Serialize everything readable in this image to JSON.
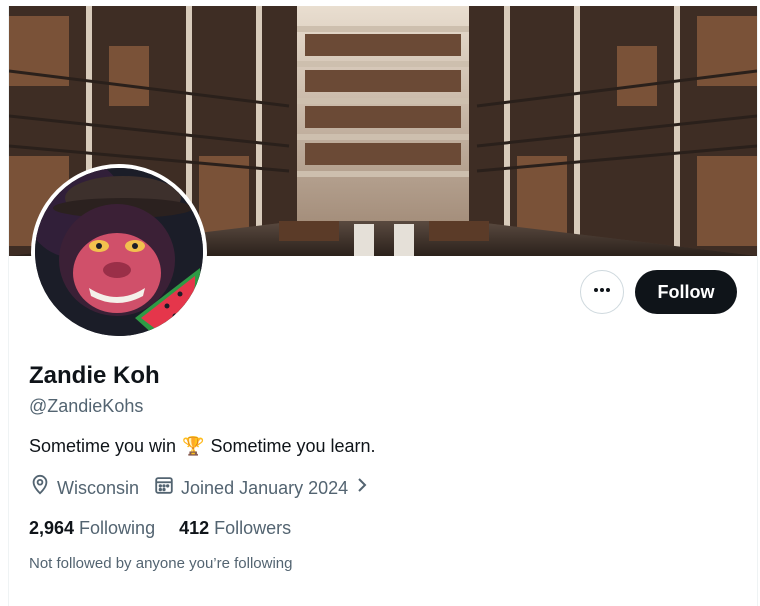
{
  "profile": {
    "display_name": "Zandie Koh",
    "handle": "@ZandieKohs",
    "bio_part1": "Sometime you win",
    "bio_emoji": "🏆",
    "bio_part2": "Sometime you learn.",
    "location": "Wisconsin",
    "joined": "Joined January 2024",
    "following_count": "2,964",
    "following_label": "Following",
    "followers_count": "412",
    "followers_label": "Followers",
    "not_followed_text": "Not followed by anyone you’re following"
  },
  "actions": {
    "follow_label": "Follow"
  },
  "banner": {
    "scene": "library interior with balconies and bookshelves"
  },
  "avatar": {
    "subject": "angry gorilla with cap holding watermelon slice"
  },
  "icons": {
    "more": "more-dots-icon",
    "location": "location-pin-icon",
    "calendar": "calendar-icon",
    "chevron": "chevron-right-icon",
    "trophy": "trophy-emoji"
  },
  "colors": {
    "primary_text": "#0f1419",
    "secondary_text": "#536471",
    "follow_button_bg": "#0f1419",
    "border": "#cfd9de"
  }
}
